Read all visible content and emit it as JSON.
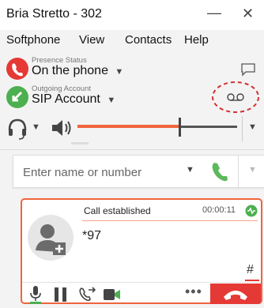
{
  "window": {
    "title": "Bria Stretto - 302",
    "minimize_glyph": "—",
    "close_glyph": "✕"
  },
  "menu": [
    "Softphone",
    "View",
    "Contacts",
    "Help"
  ],
  "presence": {
    "label": "Presence Status",
    "value": "On the phone",
    "color": "#e53935"
  },
  "account": {
    "label": "Outgoing Account",
    "value": "SIP Account",
    "color": "#4caf50"
  },
  "audio": {
    "volume_level": 0.64,
    "accent_color": "#f0643c"
  },
  "dialer": {
    "placeholder": "Enter name or number",
    "call_color": "#5cb85c"
  },
  "call": {
    "status": "Call established",
    "timer": "00:00:11",
    "number": "*97",
    "dtmf_key": "#",
    "accent_color": "#f0643c",
    "hangup_color": "#e53935",
    "more": "•••"
  },
  "icons": {
    "chat": "chat-bubble-icon",
    "voicemail": "voicemail-icon",
    "headset": "headset-icon",
    "speaker": "speaker-icon",
    "avatar": "add-contact-avatar-icon",
    "mic": "microphone-icon",
    "hold": "pause-icon",
    "transfer": "transfer-icon",
    "video": "video-icon",
    "hangup": "hangup-icon"
  }
}
